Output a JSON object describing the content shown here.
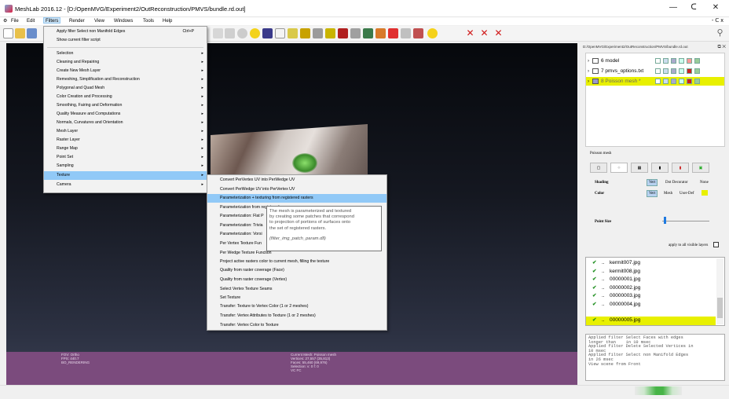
{
  "window": {
    "title": "MeshLab 2016.12 - [D:/OpenMVG/Experiment2/OutReconstruction/PMVS/bundle.rd.out]",
    "minimize": "—",
    "maximize": "ᑕ",
    "close": "✕",
    "restore_small": "- ᑕ x"
  },
  "menubar": [
    "File",
    "Edit",
    "Filters",
    "Render",
    "View",
    "Windows",
    "Tools",
    "Help"
  ],
  "filters_menu": {
    "apply_filter": "Apply filter Select non Manifold Edges",
    "apply_shortcut": "Ctrl+P",
    "show_script": "Show current filter script",
    "items": [
      "Selection",
      "Cleaning and Repairing",
      "Create New Mesh Layer",
      "Remeshing, Simplification and Reconstruction",
      "Polygonal and Quad Mesh",
      "Color Creation and Processing",
      "Smoothing, Fairing and Deformation",
      "Quality Measure and Computations",
      "Normals, Curvatures and Orientation",
      "Mesh Layer",
      "Raster Layer",
      "Range Map",
      "Point Set",
      "Sampling",
      "Texture",
      "Camera"
    ],
    "selected": "Texture"
  },
  "texture_submenu": {
    "items": [
      "Convert PerVertex UV into PerWedge UV",
      "Convert PerWedge UV into PerVertex UV",
      "Parameterization + texturing from registered rasters",
      "Parameterization from registered rasters",
      "Parameterization: Flat Plane",
      "Parameterization: Trivial Per-Triangle",
      "Parameterization: Voronoi Atlas",
      "Per Vertex Texture Function",
      "Per Wedge Texture Function",
      "Project active rasters color to current mesh, filling the texture",
      "Quality from raster coverage (Face)",
      "Quality from raster coverage (Vertex)",
      "Select Vertex Texture Seams",
      "Set Texture",
      "Transfer: Texture to Vertex Color (1 or 2 meshes)",
      "Transfer: Vertex Attributes to Texture (1 or 2 meshes)",
      "Transfer: Vertex Color to Texture"
    ],
    "visible_labels": [
      "Convert PerVertex UV into PerWedge UV",
      "Convert PerWedge UV into PerVertex UV",
      "Parameterization + texturing from registered rasters",
      "Parameterization from registered",
      "Parameterization: Flat P",
      "Parameterization: Trivia",
      "Parameterization: Vorsi",
      "Per Vertex Texture Fun",
      "Per Wedge Texture Function",
      "Project active rasters color to current mesh, filling the texture",
      "Quality from raster coverage (Face)",
      "Quality from raster coverage (Vertex)",
      "Select Vertex Texture Seams",
      "Set Texture",
      "Transfer: Texture to Vertex Color (1 or 2 meshes)",
      "Transfer: Vertex Attributes to Texture (1 or 2 meshes)",
      "Transfer: Vertex Color to Texture"
    ],
    "selected": "Parameterization + texturing from registered rasters"
  },
  "tooltip": {
    "lines": [
      "The mesh is parameterized and textured",
      "by creating some patches that correspond",
      "to projection of portions of surfaces onto",
      "the set of registered rasters."
    ],
    "plugin": "(filter_img_patch_param.dll)"
  },
  "viewport_info": {
    "left": [
      "FOV: Ortho",
      "FPS:  440.7",
      "BO_RENDERING"
    ],
    "right": [
      "Current Mesh: Poisson mesh",
      "Vertices: 27,557  (35,813)",
      "Faces: 55,460  (69,976)",
      "Selection: v: 0 f: 0",
      "VC FC"
    ]
  },
  "layers": {
    "header": "D:/OpenMVG/Experiment2/OutReconstruction/PMVS/bundle.rd.out",
    "items": [
      {
        "name": "6 model",
        "highlight": false
      },
      {
        "name": "7 pmvs_options.txt",
        "highlight": false
      },
      {
        "name": "8 Poisson mesh *",
        "highlight": true
      }
    ]
  },
  "properties": {
    "title": "Poisson mesh",
    "tabs": [
      "",
      "",
      "",
      "",
      "",
      ""
    ],
    "shading_label": "Shading",
    "shading_options": [
      "Vert",
      "Dot Decorator",
      "None"
    ],
    "color_label": "Color",
    "color_options": [
      "Vert",
      "Mesh",
      "User-Def"
    ],
    "point_size_label": "Point Size",
    "apply_all_label": "apply to all visible layers",
    "accent": "#e8f000"
  },
  "rasters": {
    "items": [
      {
        "name": "kermit007.jpg",
        "highlight": false
      },
      {
        "name": "kermit008.jpg",
        "highlight": false
      },
      {
        "name": "00000001.jpg",
        "highlight": false
      },
      {
        "name": "00000002.jpg",
        "highlight": false
      },
      {
        "name": "00000003.jpg",
        "highlight": false
      },
      {
        "name": "00000004.jpg",
        "highlight": false
      },
      {
        "name": "00000005.jpg",
        "highlight": true
      }
    ],
    "check": "✔",
    "dots": ".."
  },
  "log": {
    "text": "Applied filter Select Faces with edges\nlonger than    in 10 msec\nApplied filter Delete Selected Vertices in\n10 msec\nApplied filter Select non Manifold Edges\nin 26 msec\nView scene from Front"
  }
}
